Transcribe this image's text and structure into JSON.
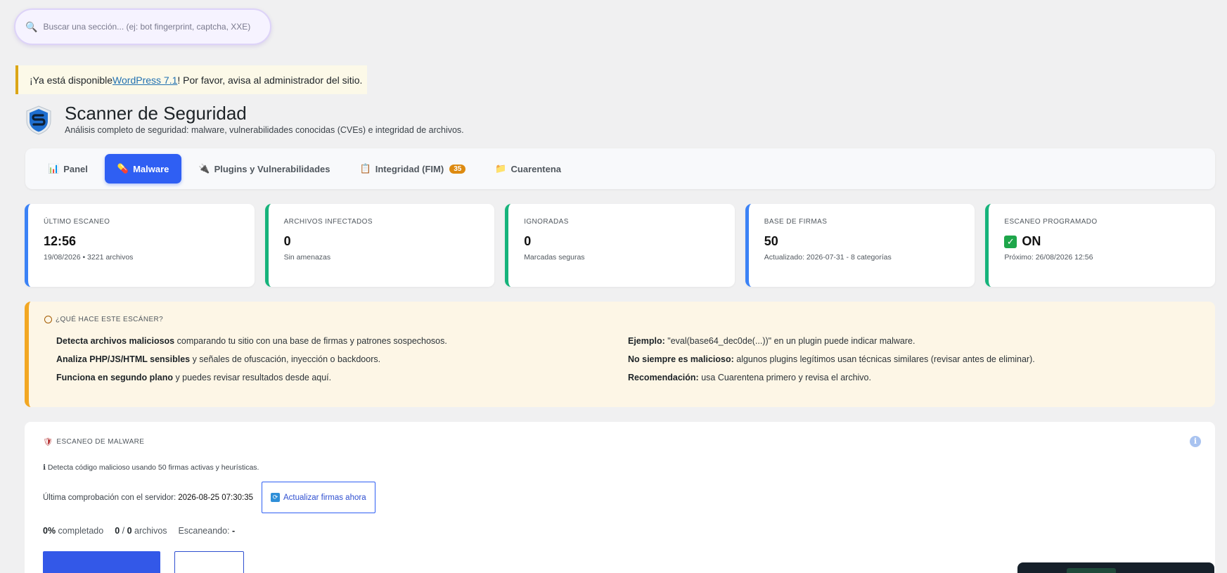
{
  "search": {
    "placeholder": "Buscar una sección... (ej: bot fingerprint, captcha, XXE)",
    "icon": "search-icon"
  },
  "notice": {
    "prefix": "¡Ya está disponible ",
    "link": "WordPress 7.1",
    "suffix": "! Por favor, avisa al administrador del sitio."
  },
  "header": {
    "title": "Scanner de Seguridad",
    "subtitle": "Análisis completo de seguridad: malware, vulnerabilidades conocidas (CVEs) e integridad de archivos."
  },
  "tabs": [
    {
      "icon": "📊",
      "label": "Panel",
      "active": false
    },
    {
      "icon": "💊",
      "label": "Malware",
      "active": true
    },
    {
      "icon": "🔌",
      "label": "Plugins y Vulnerabilidades",
      "active": false
    },
    {
      "icon": "📋",
      "label": "Integridad (FIM)",
      "active": false,
      "badge": "35"
    },
    {
      "icon": "📁",
      "label": "Cuarentena",
      "active": false
    }
  ],
  "stats": [
    {
      "label": "ÚLTIMO ESCANEO",
      "value": "12:56",
      "sub": "19/08/2026 • 3221 archivos"
    },
    {
      "label": "ARCHIVOS INFECTADOS",
      "value": "0",
      "sub": "Sin amenazas"
    },
    {
      "label": "IGNORADAS",
      "value": "0",
      "sub": "Marcadas seguras"
    },
    {
      "label": "BASE DE FIRMAS",
      "value": "50",
      "sub": "Actualizado: 2026-07-31 - 8 categorías"
    },
    {
      "label": "ESCANEO PROGRAMADO",
      "value": "ON",
      "sub": "Próximo: 26/08/2026 12:56"
    }
  ],
  "info": {
    "heading": "¿QUÉ HACE ESTE ESCÁNER?",
    "left": [
      {
        "bold": "Detecta archivos maliciosos",
        "text": " comparando tu sitio con una base de firmas y patrones sospechosos."
      },
      {
        "bold": "Analiza PHP/JS/HTML sensibles",
        "text": " y señales de ofuscación, inyección o backdoors."
      },
      {
        "bold": "Funciona en segundo plano",
        "text": " y puedes revisar resultados desde aquí."
      }
    ],
    "right": [
      {
        "bold": "Ejemplo:",
        "text": " \"eval(base64_dec0de(...))\" en un plugin puede indicar malware."
      },
      {
        "bold": "No siempre es malicioso:",
        "text": " algunos plugins legítimos usan técnicas similares (revisar antes de eliminar)."
      },
      {
        "bold": "Recomendación:",
        "text": " usa Cuarentena primero y revisa el archivo."
      }
    ]
  },
  "scan": {
    "heading": "ESCANEO DE MALWARE",
    "info_icon": "i",
    "desc": "ℹ Detecta código malicioso usando 50 firmas activas y heurísticas.",
    "server_label": "Última comprobación con el servidor:",
    "server_time": "2026-08-25 07:30:35",
    "update_button": "Actualizar firmas ahora",
    "progress_percent": "0%",
    "progress_label": " completado",
    "files_done": "0",
    "files_sep": " / ",
    "files_total": "0",
    "files_label": " archivos",
    "scanning_label": "Escaneando: ",
    "scanning_value": "-"
  }
}
